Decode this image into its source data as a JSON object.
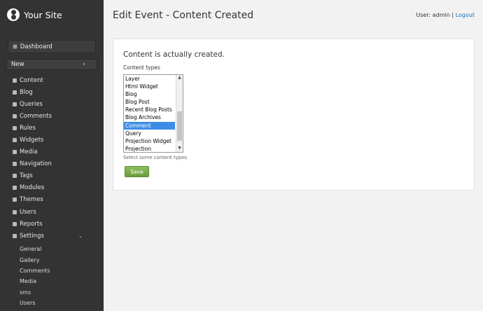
{
  "brand": {
    "name": "Your Site",
    "logo": "orchard-logo-icon"
  },
  "sidebar": {
    "dashboard": "Dashboard",
    "new": "New",
    "new_arrow": "›",
    "items": [
      {
        "label": "Content",
        "icon": "content-icon"
      },
      {
        "label": "Blog",
        "icon": "blog-icon"
      },
      {
        "label": "Queries",
        "icon": "queries-icon"
      },
      {
        "label": "Comments",
        "icon": "comments-icon"
      },
      {
        "label": "Rules",
        "icon": "rules-icon"
      },
      {
        "label": "Widgets",
        "icon": "widgets-icon"
      },
      {
        "label": "Media",
        "icon": "media-icon"
      },
      {
        "label": "Navigation",
        "icon": "navigation-icon"
      },
      {
        "label": "Tags",
        "icon": "tags-icon"
      },
      {
        "label": "Modules",
        "icon": "modules-icon"
      },
      {
        "label": "Themes",
        "icon": "themes-icon"
      },
      {
        "label": "Users",
        "icon": "users-icon"
      },
      {
        "label": "Reports",
        "icon": "reports-icon"
      },
      {
        "label": "Settings",
        "icon": "settings-icon",
        "caret": "⌄"
      }
    ],
    "settings_sub": [
      "General",
      "Gallery",
      "Comments",
      "Media",
      "sms",
      "Users"
    ]
  },
  "header": {
    "title": "Edit Event - Content Created",
    "user_label": "User: admin",
    "separator": "|",
    "logout": "Logout"
  },
  "form": {
    "heading": "Content is actually created.",
    "label": "Content types",
    "options": [
      "Layer",
      "Html Widget",
      "Blog",
      "Blog Post",
      "Recent Blog Posts",
      "Blog Archives",
      "Comment",
      "Query",
      "Projection Widget",
      "Projection"
    ],
    "selected": "Comment",
    "hint": "Select some content types.",
    "save": "Save"
  }
}
